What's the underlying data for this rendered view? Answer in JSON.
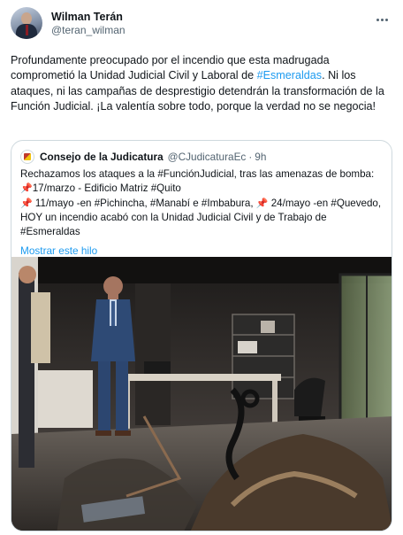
{
  "tweet": {
    "author": {
      "name": "Wilman Terán",
      "handle": "@teran_wilman"
    },
    "text": {
      "part1": "Profundamente preocupado por el incendio que esta madrugada comprometió la Unidad Judicial Civil y Laboral de ",
      "hashtag": "#Esmeraldas",
      "part2": ". Ni los ataques, ni las campañas de desprestigio detendrán la transformación de la Función Judicial. ¡La valentía sobre todo, porque la verdad no se negocia!"
    }
  },
  "quote": {
    "author": {
      "name": "Consejo de la Judicatura",
      "handle": "@CJudicaturaEc",
      "separator": "·",
      "time": "9h"
    },
    "text": {
      "line1": "Rechazamos los ataques a la #FunciónJudicial, tras las amenazas de bomba:",
      "pin": "📌",
      "line2": "17/marzo - Edificio Matriz #Quito",
      "line3a": " 11/mayo -en #Pichincha, #Manabí e #Imbabura, ",
      "line3b": " 24/mayo -en #Quevedo, HOY un incendio acabó con la Unidad Judicial Civil y de Trabajo de #Esmeraldas"
    },
    "show_thread_label": "Mostrar este hilo"
  },
  "icons": {
    "more": "more-dots-icon",
    "pin": "pushpin-icon"
  },
  "colors": {
    "link": "#1d9bf0",
    "secondary_text": "#536471",
    "border": "#cfd9de"
  }
}
